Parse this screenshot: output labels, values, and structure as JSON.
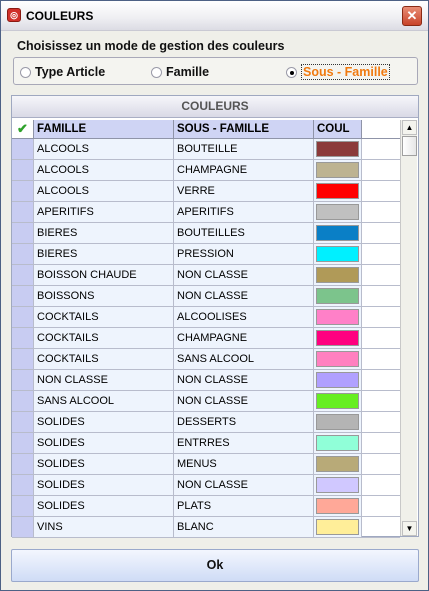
{
  "window": {
    "title": "COULEURS",
    "icon": "app-icon",
    "close_icon": "✕"
  },
  "mode": {
    "heading": "Choisissez un mode de gestion des couleurs",
    "options": [
      {
        "label": "Type Article",
        "selected": false
      },
      {
        "label": "Famille",
        "selected": false
      },
      {
        "label": "Sous - Famille",
        "selected": true
      }
    ]
  },
  "table": {
    "title": "COULEURS",
    "check_icon": "✔",
    "columns": [
      "FAMILLE",
      "SOUS - FAMILLE",
      "COUL"
    ],
    "rows": [
      {
        "famille": "ALCOOLS",
        "sous_famille": "BOUTEILLE",
        "color": "#8b3a3a"
      },
      {
        "famille": "ALCOOLS",
        "sous_famille": "CHAMPAGNE",
        "color": "#bdb391"
      },
      {
        "famille": "ALCOOLS",
        "sous_famille": "VERRE",
        "color": "#ff0000"
      },
      {
        "famille": "APERITIFS",
        "sous_famille": "APERITIFS",
        "color": "#c0c0c0"
      },
      {
        "famille": "BIERES",
        "sous_famille": "BOUTEILLES",
        "color": "#0a7fc6"
      },
      {
        "famille": "BIERES",
        "sous_famille": "PRESSION",
        "color": "#00f0ff"
      },
      {
        "famille": "BOISSON CHAUDE",
        "sous_famille": "NON CLASSE",
        "color": "#b09a58"
      },
      {
        "famille": "BOISSONS",
        "sous_famille": "NON CLASSE",
        "color": "#7cc48c"
      },
      {
        "famille": "COCKTAILS",
        "sous_famille": "ALCOOLISES",
        "color": "#ff80c8"
      },
      {
        "famille": "COCKTAILS",
        "sous_famille": "CHAMPAGNE",
        "color": "#ff0080"
      },
      {
        "famille": "COCKTAILS",
        "sous_famille": "SANS ALCOOL",
        "color": "#ff80c0"
      },
      {
        "famille": "NON CLASSE",
        "sous_famille": "NON CLASSE",
        "color": "#b0a0ff"
      },
      {
        "famille": "SANS ALCOOL",
        "sous_famille": "NON CLASSE",
        "color": "#66ee22"
      },
      {
        "famille": "SOLIDES",
        "sous_famille": "DESSERTS",
        "color": "#b4b4b4"
      },
      {
        "famille": "SOLIDES",
        "sous_famille": "ENTRRES",
        "color": "#90ffd8"
      },
      {
        "famille": "SOLIDES",
        "sous_famille": "MENUS",
        "color": "#b8aa78"
      },
      {
        "famille": "SOLIDES",
        "sous_famille": "NON CLASSE",
        "color": "#d0c8ff"
      },
      {
        "famille": "SOLIDES",
        "sous_famille": "PLATS",
        "color": "#ffa898"
      },
      {
        "famille": "VINS",
        "sous_famille": "BLANC",
        "color": "#ffee99"
      }
    ]
  },
  "scrollbar": {
    "up_icon": "▲",
    "down_icon": "▼"
  },
  "footer": {
    "ok_label": "Ok"
  }
}
